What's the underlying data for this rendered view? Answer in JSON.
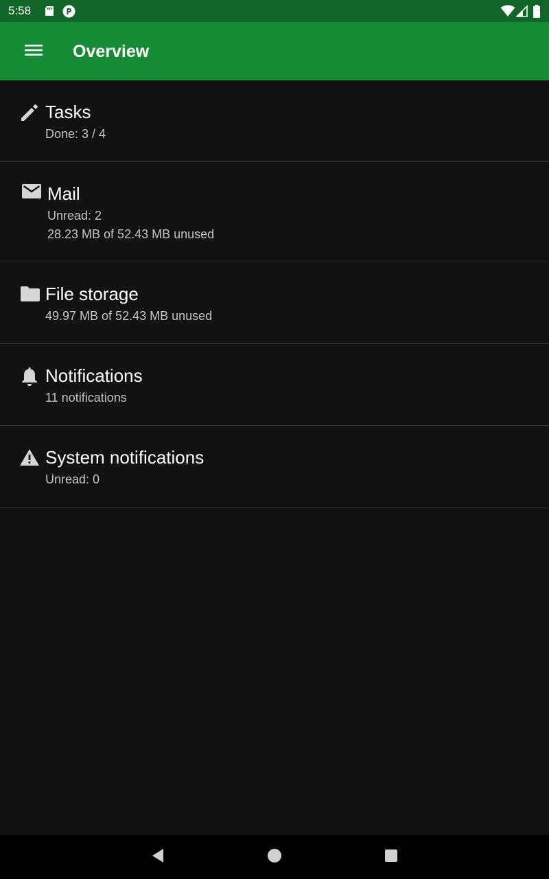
{
  "status_bar": {
    "time": "5:58",
    "left_icons": [
      "sd-card-icon",
      "app-status-icon"
    ],
    "right_icons": [
      "wifi-icon",
      "signal-icon",
      "battery-icon"
    ]
  },
  "app_bar": {
    "title": "Overview",
    "menu_icon": "hamburger-menu-icon",
    "background": "#168b36",
    "status_background": "#116528"
  },
  "items": [
    {
      "icon": "pencil-icon",
      "title": "Tasks",
      "lines": [
        "Done: 3 / 4"
      ]
    },
    {
      "icon": "mail-icon",
      "title": "Mail",
      "lines": [
        "Unread: 2",
        "28.23 MB of 52.43 MB unused"
      ]
    },
    {
      "icon": "folder-icon",
      "title": "File storage",
      "lines": [
        "49.97 MB of 52.43 MB unused"
      ]
    },
    {
      "icon": "bell-icon",
      "title": "Notifications",
      "lines": [
        "11 notifications"
      ]
    },
    {
      "icon": "warning-icon",
      "title": "System notifications",
      "lines": [
        "Unread: 0"
      ]
    }
  ],
  "nav_bar": {
    "buttons": [
      "back-icon",
      "home-icon",
      "recents-icon"
    ]
  },
  "colors": {
    "background": "#121212",
    "divider": "#343434",
    "title_text": "#ffffff",
    "secondary_text": "#c4c4c4",
    "icon": "#d6d6d6"
  }
}
